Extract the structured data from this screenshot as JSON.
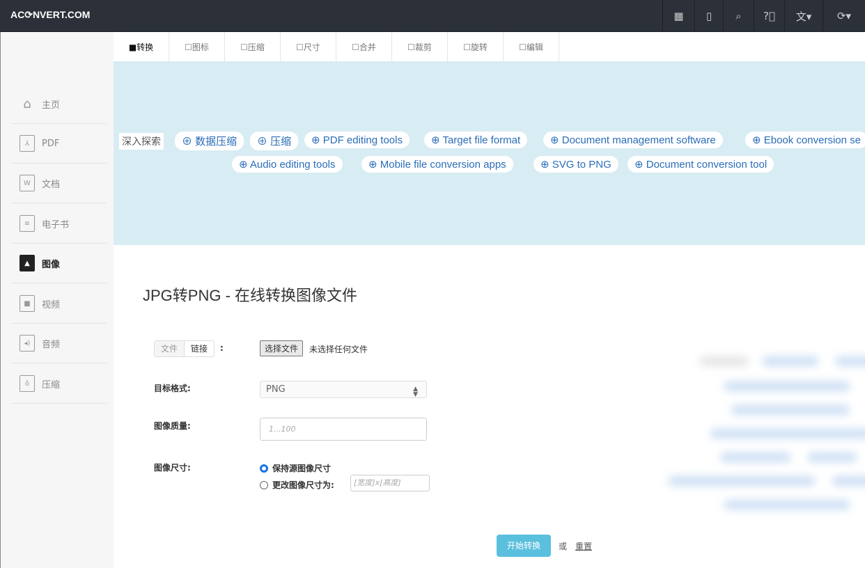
{
  "header": {
    "logo": "AC⟳NVERT.COM",
    "icons": [
      "grid-icon",
      "tablet-icon",
      "search-icon",
      "help-icon",
      "language-icon",
      "sync-icon"
    ]
  },
  "tabs": [
    {
      "label": "■转换",
      "active": true
    },
    {
      "label": "☐图标"
    },
    {
      "label": "☐压缩"
    },
    {
      "label": "☐尺寸"
    },
    {
      "label": "☐合并"
    },
    {
      "label": "☐裁剪"
    },
    {
      "label": "☐旋转"
    },
    {
      "label": "☐编辑"
    }
  ],
  "sidebar": {
    "items": [
      {
        "label": "主页",
        "icon": "home-icon"
      },
      {
        "label": "PDF",
        "icon": "pdf-icon"
      },
      {
        "label": "文档",
        "icon": "word-icon"
      },
      {
        "label": "电子书",
        "icon": "ebook-icon"
      },
      {
        "label": "图像",
        "icon": "image-icon",
        "active": true
      },
      {
        "label": "视频",
        "icon": "video-icon"
      },
      {
        "label": "音频",
        "icon": "audio-icon"
      },
      {
        "label": "压缩",
        "icon": "archive-icon"
      }
    ]
  },
  "banner": {
    "explore": "深入探索",
    "tags_row1": [
      "⊕ 数据压缩",
      "⊕ 压缩",
      "⊕ PDF editing tools",
      "⊕ Target file format",
      "⊕ Document management software",
      "⊕ Ebook conversion se"
    ],
    "tags_row2": [
      "⊕ Audio editing tools",
      "⊕ Mobile file conversion apps",
      "⊕ SVG to PNG",
      "⊕ Document conversion tool"
    ]
  },
  "main": {
    "title": "JPG转PNG - 在线转换图像文件",
    "source_tabs": [
      "文件",
      "链接"
    ],
    "colon": ":",
    "choose_file": "选择文件",
    "no_file": "未选择任何文件",
    "target_label": "目标格式:",
    "target_value": "PNG",
    "quality_label": "图像质量:",
    "quality_placeholder": "1...100",
    "size_label": "图像尺寸:",
    "size_keep": "保持源图像尺寸",
    "size_change": "更改图像尺寸为:",
    "size_placeholder": "[宽度]x[高度]",
    "start": "开始转换",
    "or": "或",
    "reset": "重置"
  },
  "colors": {
    "topbar": "#2b3039",
    "banner": "#d8ecf3",
    "primary_button": "#5bc0de",
    "link": "#2a6db8"
  }
}
